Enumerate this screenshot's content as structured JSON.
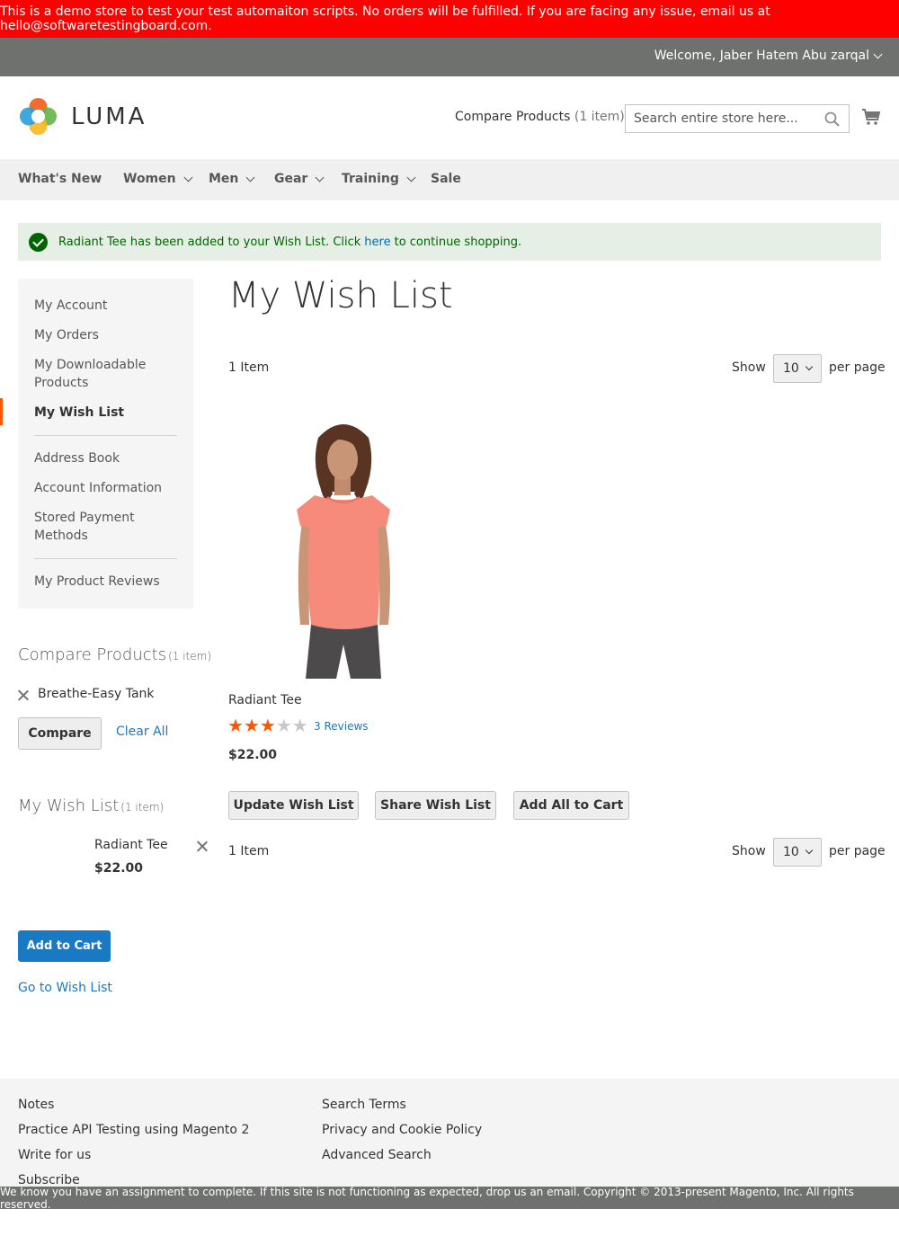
{
  "demo_banner": "This is a demo store to test your test automaiton scripts. No orders will be fulfilled. If you are facing any issue, email us at hello@softwaretestingboard.com.",
  "panel": {
    "welcome": "Welcome, Jaber Hatem Abu zarqal"
  },
  "header": {
    "logo_text": "LUMA",
    "compare_label": "Compare Products",
    "compare_count": "(1 item)",
    "search_placeholder": "Search entire store here...",
    "icons": [
      "search-icon",
      "cart-icon"
    ]
  },
  "nav": {
    "items": [
      {
        "label": "What's New",
        "has_dropdown": false
      },
      {
        "label": "Women",
        "has_dropdown": true
      },
      {
        "label": "Men",
        "has_dropdown": true
      },
      {
        "label": "Gear",
        "has_dropdown": true
      },
      {
        "label": "Training",
        "has_dropdown": true
      },
      {
        "label": "Sale",
        "has_dropdown": false
      }
    ]
  },
  "message": {
    "text_before": "Radiant Tee has been added to your Wish List. Click",
    "link": "here",
    "text_after": "to continue shopping."
  },
  "account_nav": {
    "items": [
      {
        "label": "My Account"
      },
      {
        "label": "My Orders"
      },
      {
        "label": "My Downloadable Products"
      },
      {
        "label": "My Wish List",
        "current": true
      },
      {
        "label": "Address Book"
      },
      {
        "label": "Account Information"
      },
      {
        "label": "Stored Payment Methods"
      },
      {
        "label": "My Product Reviews"
      }
    ]
  },
  "compare_block": {
    "title": "Compare Products",
    "count": "(1 item)",
    "item": "Breathe-Easy Tank",
    "compare_button": "Compare",
    "clear_all": "Clear All"
  },
  "wishlist_block": {
    "title": "My Wish List",
    "count": "(1 item)",
    "item_name": "Radiant Tee",
    "item_price": "$22.00",
    "add_to_cart": "Add to Cart",
    "go_to_wishlist": "Go to Wish List"
  },
  "main": {
    "title": "My Wish List",
    "toolbar": {
      "amount": "1 Item",
      "show_label": "Show",
      "limit": "10",
      "per_page": "per page"
    },
    "product": {
      "name": "Radiant Tee",
      "rating_stars": 3,
      "rating_max": 5,
      "reviews": "3 Reviews",
      "price": "$22.00"
    },
    "actions": {
      "update": "Update Wish List",
      "share": "Share Wish List",
      "add_all": "Add All to Cart"
    }
  },
  "footer": {
    "col1": [
      "Notes",
      "Practice API Testing using Magento 2",
      "Write for us",
      "Subscribe"
    ],
    "col2": [
      "Search Terms",
      "Privacy and Cookie Policy",
      "Advanced Search"
    ],
    "copyright": "We know you have an assignment to complete. If this site is not functioning as expected, drop us an email. Copyright © 2013-present Magento, Inc. All rights reserved."
  },
  "colors": {
    "banner": "#ff0000",
    "panel": "#6e716e",
    "link": "#1979c3",
    "accent": "#ff5501",
    "success_bg": "#e5efe5",
    "success_text": "#006400"
  }
}
